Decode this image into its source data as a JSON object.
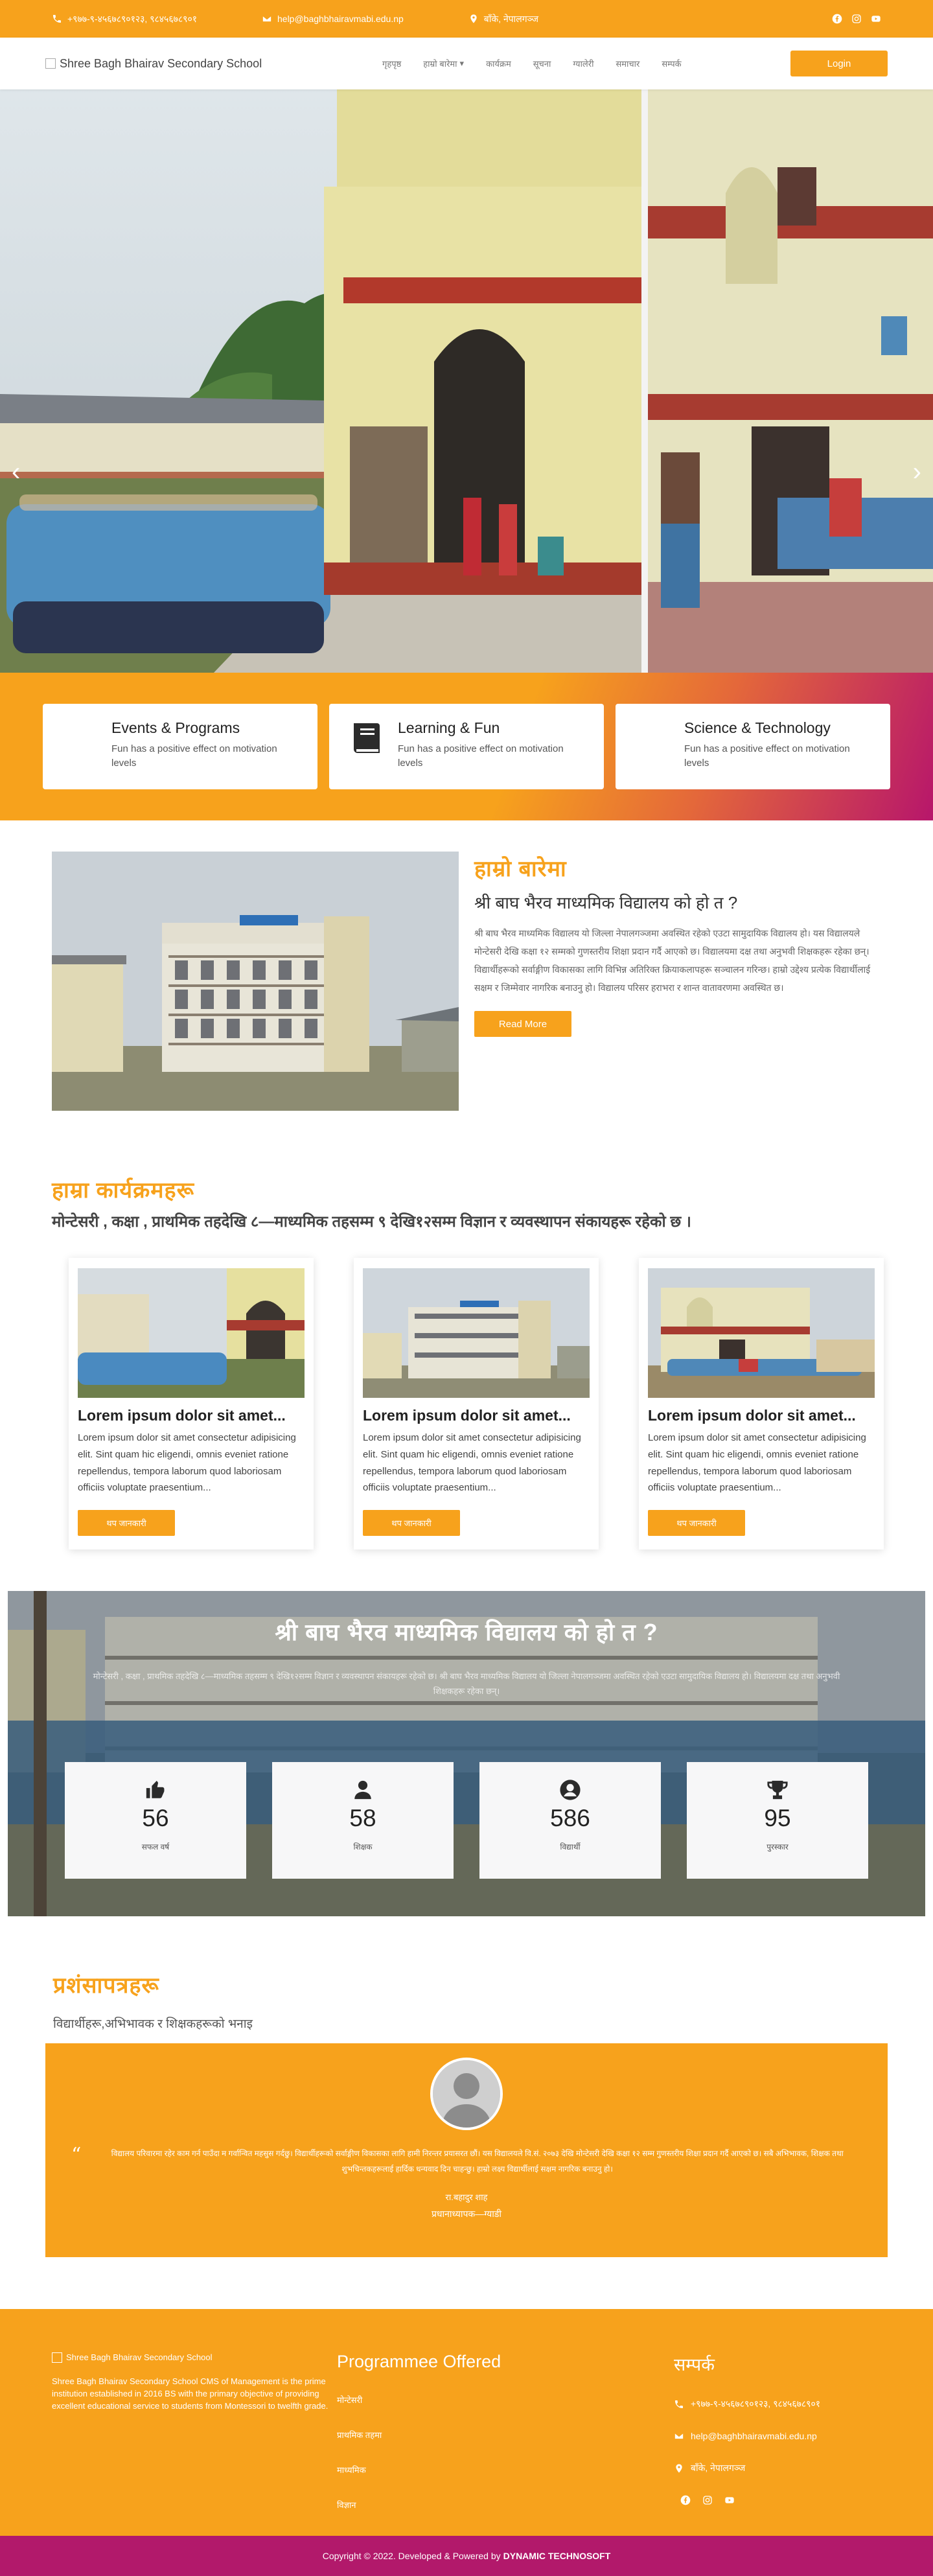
{
  "topbar": {
    "phone": "+९७७-९-४५६७८९०१२३, ९८४५६७८९०१",
    "email": "help@baghbhairavmabi.edu.np",
    "address": "बाँके, नेपालगञ्ज",
    "social_icons": [
      "facebook-icon",
      "instagram-icon",
      "youtube-icon"
    ]
  },
  "navbar": {
    "logo_alt": "Shree Bagh Bhairav Secondary School",
    "links": [
      "गृहपृष्ठ",
      "हाम्रो बारेमा",
      "कार्यक्रम",
      "सूचना",
      "ग्यालेरी",
      "समाचार",
      "सम्पर्क"
    ],
    "login": "Login"
  },
  "hero": {
    "prev": "‹",
    "next": "›"
  },
  "features": [
    {
      "title": "Events & Programs",
      "text": "Fun has a positive effect on motivation levels",
      "icon": "calendar-icon"
    },
    {
      "title": "Learning & Fun",
      "text": "Fun has a positive effect on motivation levels",
      "icon": "book-icon"
    },
    {
      "title": "Science & Technology",
      "text": "Fun has a positive effect on motivation levels",
      "icon": "flask-icon"
    }
  ],
  "about": {
    "title": "हाम्रो बारेमा",
    "heading": "श्री बाघ भैरव माध्यमिक विद्यालय को हो त ?",
    "body": "श्री बाघ भैरव माध्यमिक विद्यालय यो जिल्ला नेपालगञ्जमा अवस्थित रहेको एउटा सामुदायिक विद्यालय हो। यस विद्यालयले मोन्टेसरी देखि कक्षा १२ सम्मको गुणस्तरीय शिक्षा प्रदान गर्दै आएको छ। विद्यालयमा दक्ष तथा अनुभवी शिक्षकहरू रहेका छन्। विद्यार्थीहरूको सर्वाङ्गीण विकासका लागि विभिन्न अतिरिक्त क्रियाकलापहरू सञ्चालन गरिन्छ। हाम्रो उद्देश्य प्रत्येक विद्यार्थीलाई सक्षम र जिम्मेवार नागरिक बनाउनु हो। विद्यालय परिसर हराभरा र शान्त वातावरणमा अवस्थित छ।",
    "button": "Read More"
  },
  "programs": {
    "title": "हाम्रा कार्यक्रमहरू",
    "heading": "मोन्टेसरी , कक्षा , प्राथमिक तहदेखि ८—माध्यमिक तहसम्म ९ देखि१२सम्म विज्ञान र व्यवस्थापन संकायहरू रहेको छ ।",
    "cards": [
      {
        "title": "Lorem ipsum dolor sit amet...",
        "text": "Lorem ipsum dolor sit amet consectetur adipisicing elit. Sint quam hic eligendi, omnis eveniet ratione repellendus, tempora laborum quod laboriosam officiis voluptate praesentium...",
        "button": "थप जानकारी"
      },
      {
        "title": "Lorem ipsum dolor sit amet...",
        "text": "Lorem ipsum dolor sit amet consectetur adipisicing elit. Sint quam hic eligendi, omnis eveniet ratione repellendus, tempora laborum quod laboriosam officiis voluptate praesentium...",
        "button": "थप जानकारी"
      },
      {
        "title": "Lorem ipsum dolor sit amet...",
        "text": "Lorem ipsum dolor sit amet consectetur adipisicing elit. Sint quam hic eligendi, omnis eveniet ratione repellendus, tempora laborum quod laboriosam officiis voluptate praesentium...",
        "button": "थप जानकारी"
      }
    ]
  },
  "stats": {
    "title": "श्री बाघ भैरव माध्यमिक विद्यालय को हो त ?",
    "subtitle": "मोन्टेसरी , कक्षा , प्राथमिक तहदेखि ८—माध्यमिक तहसम्म ९ देखि१२सम्म विज्ञान र व्यवस्थापन संकायहरू रहेको छ। श्री बाघ भैरव माध्यमिक विद्यालय यो जिल्ला नेपालगञ्जमा अवस्थित रहेको एउटा सामुदायिक विद्यालय हो। विद्यालयमा दक्ष तथा अनुभवी शिक्षकहरू रहेका छन्।",
    "items": [
      {
        "icon": "thumbs-up-icon",
        "value": "56",
        "label": "सफल वर्ष"
      },
      {
        "icon": "user-icon",
        "value": "58",
        "label": "शिक्षक"
      },
      {
        "icon": "user-circle-icon",
        "value": "586",
        "label": "विद्यार्थी"
      },
      {
        "icon": "trophy-icon",
        "value": "95",
        "label": "पुरस्कार"
      }
    ]
  },
  "testimonials": {
    "title": "प्रशंसापत्रहरू",
    "subtitle": "विद्यार्थीहरू,अभिभावक र शिक्षकहरूको भनाइ",
    "quote": "विद्यालय परिवारमा रहेर काम गर्न पाउँदा म गर्वान्वित महसुस गर्दछु। विद्यार्थीहरूको सर्वाङ्गीण विकासका लागि हामी निरन्तर प्रयासरत छौं। यस विद्यालयले वि.सं. २०७३ देखि मोन्टेसरी देखि कक्षा १२ सम्म गुणस्तरीय शिक्षा प्रदान गर्दै आएको छ। सबै अभिभावक, शिक्षक तथा शुभचिन्तकहरूलाई हार्दिक धन्यवाद दिन चाहन्छु। हाम्रो लक्ष्य विद्यार्थीलाई सक्षम नागरिक बनाउनु हो।",
    "name": "रा.बहादुर शाह",
    "role": "प्रधानाध्यापक—ग्याडी"
  },
  "footer": {
    "logo_alt": "Shree Bagh Bhairav Secondary School",
    "about": "Shree Bagh Bhairav Secondary School CMS of Management is the prime institution established in 2016 BS with the primary objective of providing excellent educational service to students from Montessori to twelfth grade.",
    "programs_title": "Programmee Offered",
    "programs": [
      "मोन्टेसरी",
      "प्राथमिक तहमा",
      "माध्यमिक",
      "विज्ञान"
    ],
    "contact_title": "सम्पर्क",
    "phone": "+९७७-९-४५६७८९०१२३, ९८४५६७८९०१",
    "email": "help@baghbhairavmabi.edu.np",
    "address": "बाँके, नेपालगञ्ज"
  },
  "copyright": {
    "text": "Copyright © 2022. Developed & Powered by",
    "company": "DYNAMIC TECHNOSOFT"
  },
  "colors": {
    "accent": "#f7a21c",
    "footer_bottom": "#b2196b"
  }
}
